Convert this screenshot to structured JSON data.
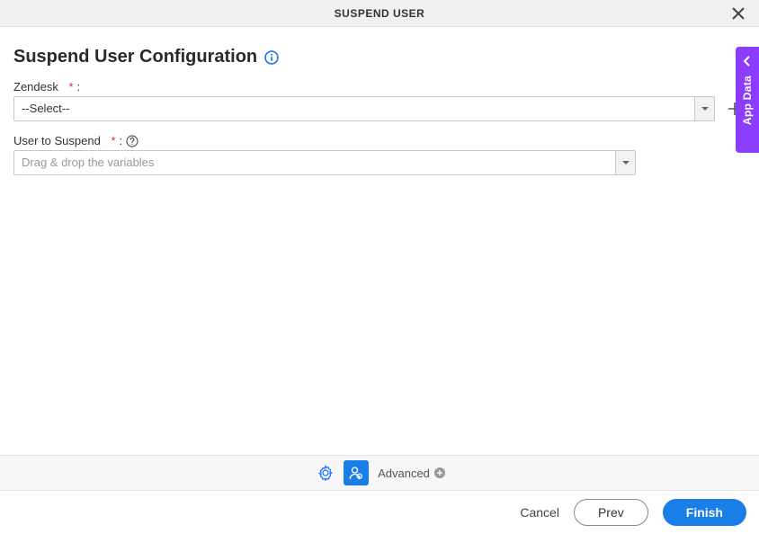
{
  "header": {
    "title": "SUSPEND USER"
  },
  "page": {
    "title": "Suspend User Configuration"
  },
  "fields": {
    "zendesk": {
      "label": "Zendesk",
      "required_mark": "*",
      "colon": ":",
      "selected": "--Select--"
    },
    "user_to_suspend": {
      "label": "User to Suspend",
      "required_mark": "*",
      "colon": ":",
      "placeholder": "Drag & drop the variables"
    }
  },
  "side_tab": {
    "label": "App Data"
  },
  "toolbar": {
    "advanced_label": "Advanced"
  },
  "footer": {
    "cancel": "Cancel",
    "prev": "Prev",
    "finish": "Finish"
  }
}
